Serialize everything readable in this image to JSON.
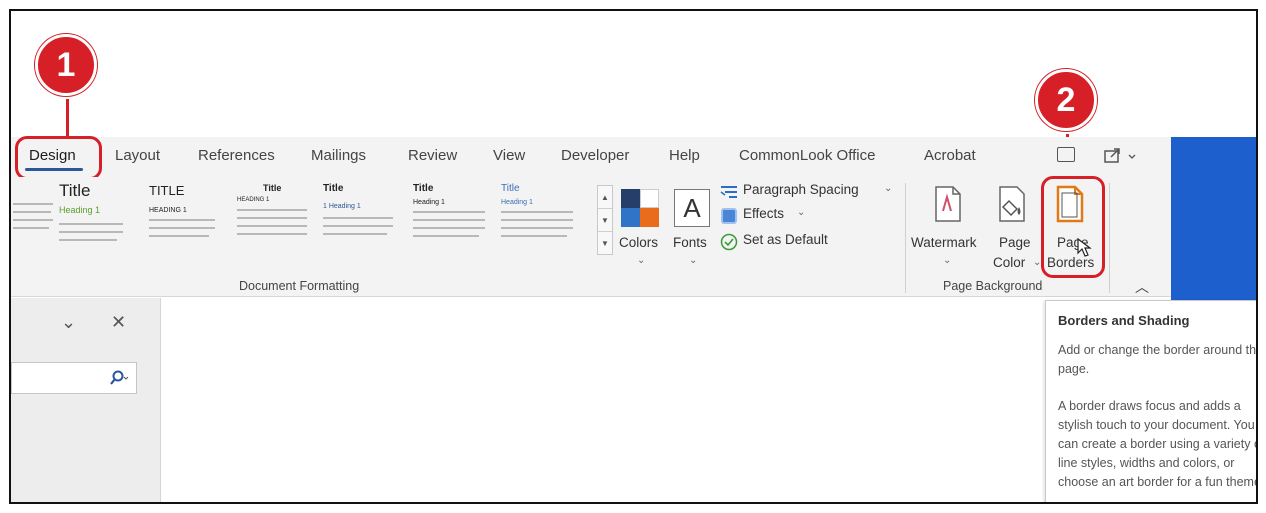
{
  "tabs": [
    {
      "label": "Design",
      "active": true
    },
    {
      "label": "Layout"
    },
    {
      "label": "References"
    },
    {
      "label": "Mailings"
    },
    {
      "label": "Review"
    },
    {
      "label": "View"
    },
    {
      "label": "Developer"
    },
    {
      "label": "Help"
    },
    {
      "label": "CommonLook Office"
    },
    {
      "label": "Acrobat"
    }
  ],
  "gallery": {
    "styles": [
      {
        "title": "Title",
        "sub": "Heading 1"
      },
      {
        "title": "TITLE",
        "sub": "HEADING 1"
      },
      {
        "title": "Title",
        "sub": "HEADING 1"
      },
      {
        "title": "Title",
        "sub": "1 Heading 1"
      },
      {
        "title": "Title",
        "sub": "Heading 1"
      },
      {
        "title": "Title",
        "sub": "Heading 1"
      }
    ]
  },
  "document_formatting": {
    "colors_label": "Colors",
    "fonts_label": "Fonts",
    "fonts_glyph": "A",
    "paragraph_spacing_label": "Paragraph Spacing",
    "effects_label": "Effects",
    "set_default_label": "Set as Default",
    "group_label": "Document Formatting"
  },
  "page_background": {
    "watermark_label": "Watermark",
    "page_color_line1": "Page",
    "page_color_line2": "Color",
    "page_borders_line1": "Page",
    "page_borders_line2": "Borders",
    "group_label": "Page Background"
  },
  "tooltip": {
    "title": "Borders and Shading",
    "para1": "Add or change the border around the page.",
    "para2": "A border draws focus and adds a stylish touch to your document. You can create a border using a variety of line styles, widths and colors, or choose an art border for a fun theme."
  },
  "badges": {
    "one": "1",
    "two": "2"
  },
  "icons": {
    "collapse_ribbon": "chevron-up-icon",
    "close": "close-icon",
    "dropdown": "chevron-down-icon",
    "search": "search-icon"
  },
  "colors": {
    "accent_blue": "#2b579a",
    "callout_red": "#d61f26",
    "page_border_orange": "#e07a16",
    "side_blue": "#1e5fce"
  }
}
